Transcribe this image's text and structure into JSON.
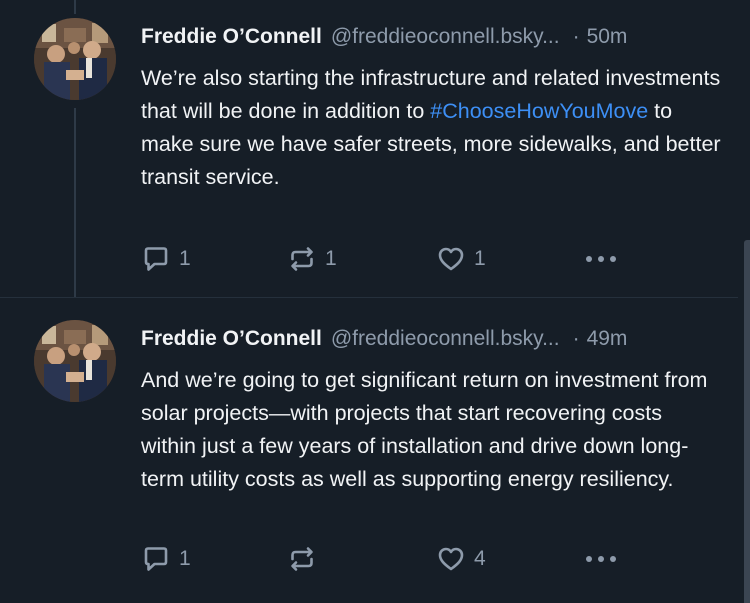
{
  "posts": [
    {
      "author_name": "Freddie O’Connell",
      "author_handle": "@freddieoconnell.bsky...",
      "separator": "·",
      "time": "50m",
      "text_before": "We’re also starting the infrastructure and related investments that will be done in addition to ",
      "hashtag": "#ChooseHowYouMove",
      "text_after": " to make sure we have safer streets, more sidewalks, and better transit service.",
      "reply_count": "1",
      "repost_count": "1",
      "like_count": "1",
      "icons": [
        "reply-icon",
        "repost-icon",
        "like-icon",
        "more-icon"
      ]
    },
    {
      "author_name": "Freddie O’Connell",
      "author_handle": "@freddieoconnell.bsky...",
      "separator": "·",
      "time": "49m",
      "text": "And we’re going to get significant return on investment from solar projects—with projects that start recovering costs within just a few years of installation and drive down long-term utility costs as well as supporting energy resiliency.",
      "reply_count": "1",
      "repost_count": "",
      "like_count": "4",
      "icons": [
        "reply-icon",
        "repost-icon",
        "like-icon",
        "more-icon"
      ]
    }
  ],
  "colors": {
    "background": "#161e27",
    "text": "#f1f3f5",
    "muted": "#8e9bab",
    "hashtag": "#3d8ff5",
    "thread_line": "#2e3a47"
  }
}
